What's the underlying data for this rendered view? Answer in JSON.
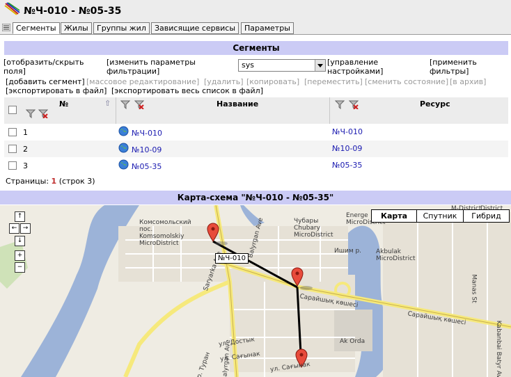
{
  "window": {
    "title": "№Ч-010 - №05-35"
  },
  "tabs": [
    {
      "label": "Сегменты",
      "active": true
    },
    {
      "label": "Жилы",
      "active": false
    },
    {
      "label": "Группы жил",
      "active": false
    },
    {
      "label": "Зависящие сервисы",
      "active": false
    },
    {
      "label": "Параметры",
      "active": false
    }
  ],
  "section": {
    "title": "Сегменты",
    "toolbar": {
      "toggle_fields": "[отобразить/скрыть поля]",
      "filter_params": "[изменить параметры фильтрации]",
      "filter_select": "sys",
      "manage_settings": "[управление настройками]",
      "apply_filters": "[применить фильтры]"
    },
    "actions": {
      "add": "[добавить сегмент]",
      "bulk_edit": "[массовое редактирование]",
      "delete": "[удалить]",
      "copy": "[копировать]",
      "move": "[переместить]",
      "change_state": "[сменить состояние]",
      "archive": "[в архив]",
      "export": "[экспортировать в файл]",
      "export_all": "[экспортировать весь список в файл]"
    },
    "table": {
      "columns": {
        "num": "№",
        "name": "Название",
        "resource": "Ресурс"
      },
      "rows": [
        {
          "num": "1",
          "name": "№Ч-010",
          "resource": "№Ч-010"
        },
        {
          "num": "2",
          "name": "№10-09",
          "resource": "№10-09"
        },
        {
          "num": "3",
          "name": "№05-35",
          "resource": "№05-35"
        }
      ]
    },
    "pagination": {
      "label": "Страницы:",
      "current": "1",
      "count": "(строк 3)"
    }
  },
  "map": {
    "title": "Карта-схема \"№Ч-010 - №05-35\"",
    "types": [
      {
        "label": "Карта",
        "active": true
      },
      {
        "label": "Спутник",
        "active": false
      },
      {
        "label": "Гибрид",
        "active": false
      }
    ],
    "tooltip": "№Ч-010",
    "labels": {
      "komsomolsky": "Комсомольский\nпос.\nKomsomolskiy\nMicroDistrict",
      "chubary": "Чубары\nChubary\nMicroDistrict",
      "energetic": "Energe\nMicroDistrict",
      "m_district": "M-District",
      "district": "District",
      "ishim": "Ишим р.",
      "akbulak": "Akbulak\nMicroDistrict",
      "saraishyk": "Сарайшық көшесі",
      "saraishyk2": "Сарайшық көшесі",
      "ak_orda": "Ak Orda",
      "dostyk": "ул. Достык",
      "sagynak": "ул. Сағынак",
      "sagynak2": "ул. Сағынак",
      "saryarka": "Saryarka Ave",
      "balyrgan": "Balyrgan Ave",
      "balyrgan2": "Balyrgan Ave",
      "turan": "пр. Туран",
      "manas": "Manas St",
      "kabanbai": "Kabanbai Batyr Ave"
    },
    "colors": {
      "water": "#9cb3d8",
      "road_yellow": "#f6e97c",
      "marker": "#e84b3b",
      "route": "#000000"
    }
  }
}
